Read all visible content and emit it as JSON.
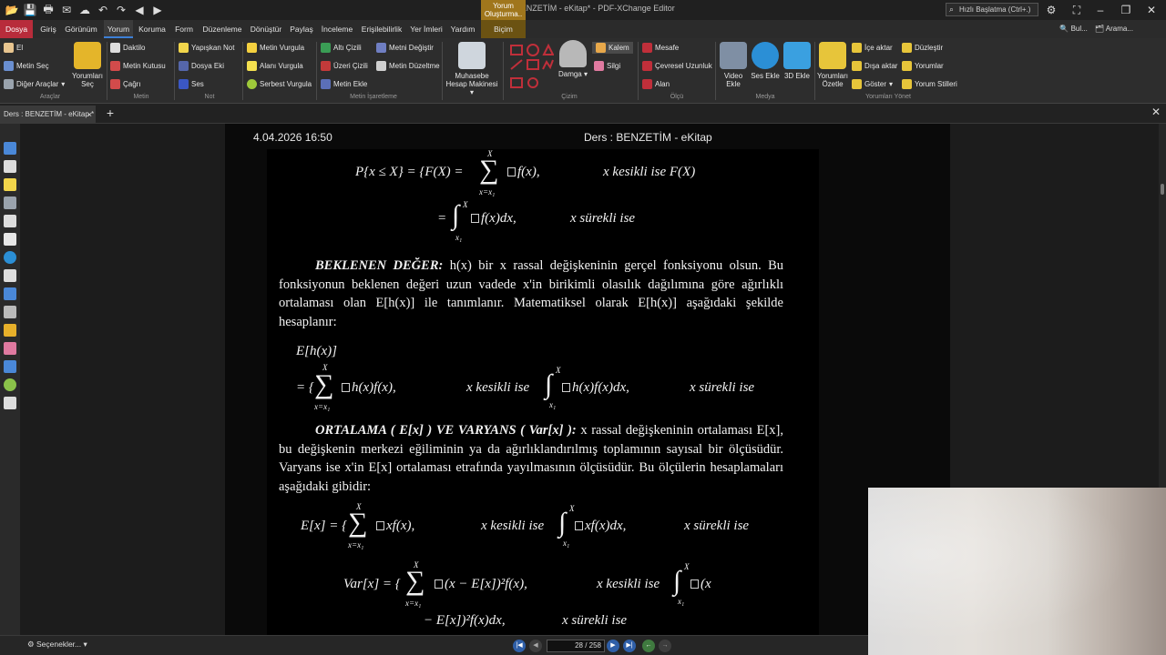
{
  "window": {
    "title": "Ders : BENZETİM - eKitap* - PDF-XChange Editor",
    "context_tab": "Yorum Oluşturma..",
    "quick_launch_placeholder": "Hızlı Başlatma (Ctrl+.)"
  },
  "menubar": {
    "tabs": [
      "Dosya",
      "Giriş",
      "Görünüm",
      "Yorum",
      "Koruma",
      "Form",
      "Düzenleme",
      "Dönüştür",
      "Paylaş",
      "İnceleme",
      "Erişilebilirlik",
      "Yer İmleri",
      "Yardım",
      "Biçim"
    ],
    "right": [
      "Bul...",
      "Arama..."
    ]
  },
  "ribbon": {
    "araclar": {
      "label": "Araçlar",
      "items": [
        "El",
        "Metin Seç",
        "Diğer Araçlar"
      ],
      "big": "Yorumları Seç"
    },
    "metin": {
      "label": "Metin",
      "items": [
        "Daktilo",
        "Metin Kutusu",
        "Çağrı"
      ]
    },
    "not": {
      "label": "Not",
      "items": [
        "Yapışkan Not",
        "Dosya Eki",
        "Ses"
      ]
    },
    "vurgu": {
      "items": [
        "Metin Vurgula",
        "Alanı Vurgula",
        "Serbest Vurgula"
      ]
    },
    "metin_isaretleme": {
      "label": "Metin İşaretleme",
      "items": [
        "Altı Çizili",
        "Üzeri Çizili",
        "Metin Ekle",
        "Metni Değiştir",
        "Metin Düzeltme"
      ]
    },
    "muhasebe": {
      "label": "Muhasebe Hesap Makinesi"
    },
    "cizim": {
      "label": "Çizim",
      "damga": "Damga",
      "kalem": "Kalem",
      "silgi": "Silgi"
    },
    "olcu": {
      "label": "Ölçü",
      "items": [
        "Mesafe",
        "Çevresel Uzunluk",
        "Alan"
      ]
    },
    "medya": {
      "label": "Medya",
      "items": [
        "Video Ekle",
        "Ses Ekle",
        "3D Ekle"
      ]
    },
    "yorumlari_yonet": {
      "label": "Yorumları Yönet",
      "big": "Yorumları Özetle",
      "items": [
        "İçe aktar",
        "Dışa aktar",
        "Göster",
        "Düzleştir",
        "Yorumlar",
        "Yorum Stilleri"
      ]
    }
  },
  "document_tab": {
    "label": "Ders : BENZETİM - eKitap *"
  },
  "page": {
    "header_left": "4.04.2026 16:50",
    "header_center": "Ders : BENZETİM - eKitap",
    "beklenen_heading": "BEKLENEN DEĞER:",
    "beklenen_text": "h(x) bir x rassal değişkeninin gerçel fonksiyonu olsun. Bu fonksiyonun beklenen değeri uzun vadede x'in birikimli olasılık dağılımına göre ağırlıklı ortalaması olan E[h(x)] ile tanımlanır. Matematiksel olarak E[h(x)] aşağıdaki şekilde hesaplanır:",
    "ortalama_heading": "ORTALAMA ( E[x] ) VE VARYANS ( Var[x] ):",
    "ortalama_text": "x rassal değişkeninin ortalaması E[x], bu değişkenin merkezi eğiliminin ya da ağırlıklandırılmış toplamının sayısal bir ölçüsüdür. Varyans ise x'in E[x] ortalaması etrafında yayılmasının ölçüsüdür. Bu ölçülerin hesaplamaları aşağıdaki gibidir:",
    "eq": {
      "p_left": "P{x ≤ X} = {F(X) =",
      "f_x": "f(x),",
      "kesikli_F": "x kesikli ise F(X)",
      "eq2_eq": "=",
      "fxdx": "f(x)dx,",
      "surekli": "x sürekli ise",
      "Ehx": "E[h(x)]",
      "eq_brace": "= {",
      "hxfx": "h(x)f(x),",
      "kesikli_ise": "x kesikli ise",
      "hxfxdx": "h(x)f(x)dx,",
      "Ex_left": "E[x] = {",
      "xfx": "xf(x),",
      "xfxdx": "xf(x)dx,",
      "Var_left": "Var[x] = {",
      "var_sum": "(x − E[x])²f(x),",
      "var_int_tail": "(x",
      "var_line2": "− E[x])²f(x)dx,",
      "lim_top": "X",
      "lim_bottom": "x=x₁",
      "lim_bottom_int": "x₁"
    }
  },
  "statusbar": {
    "options": "Seçenekler...",
    "current_page": "28",
    "total_pages": "258"
  }
}
